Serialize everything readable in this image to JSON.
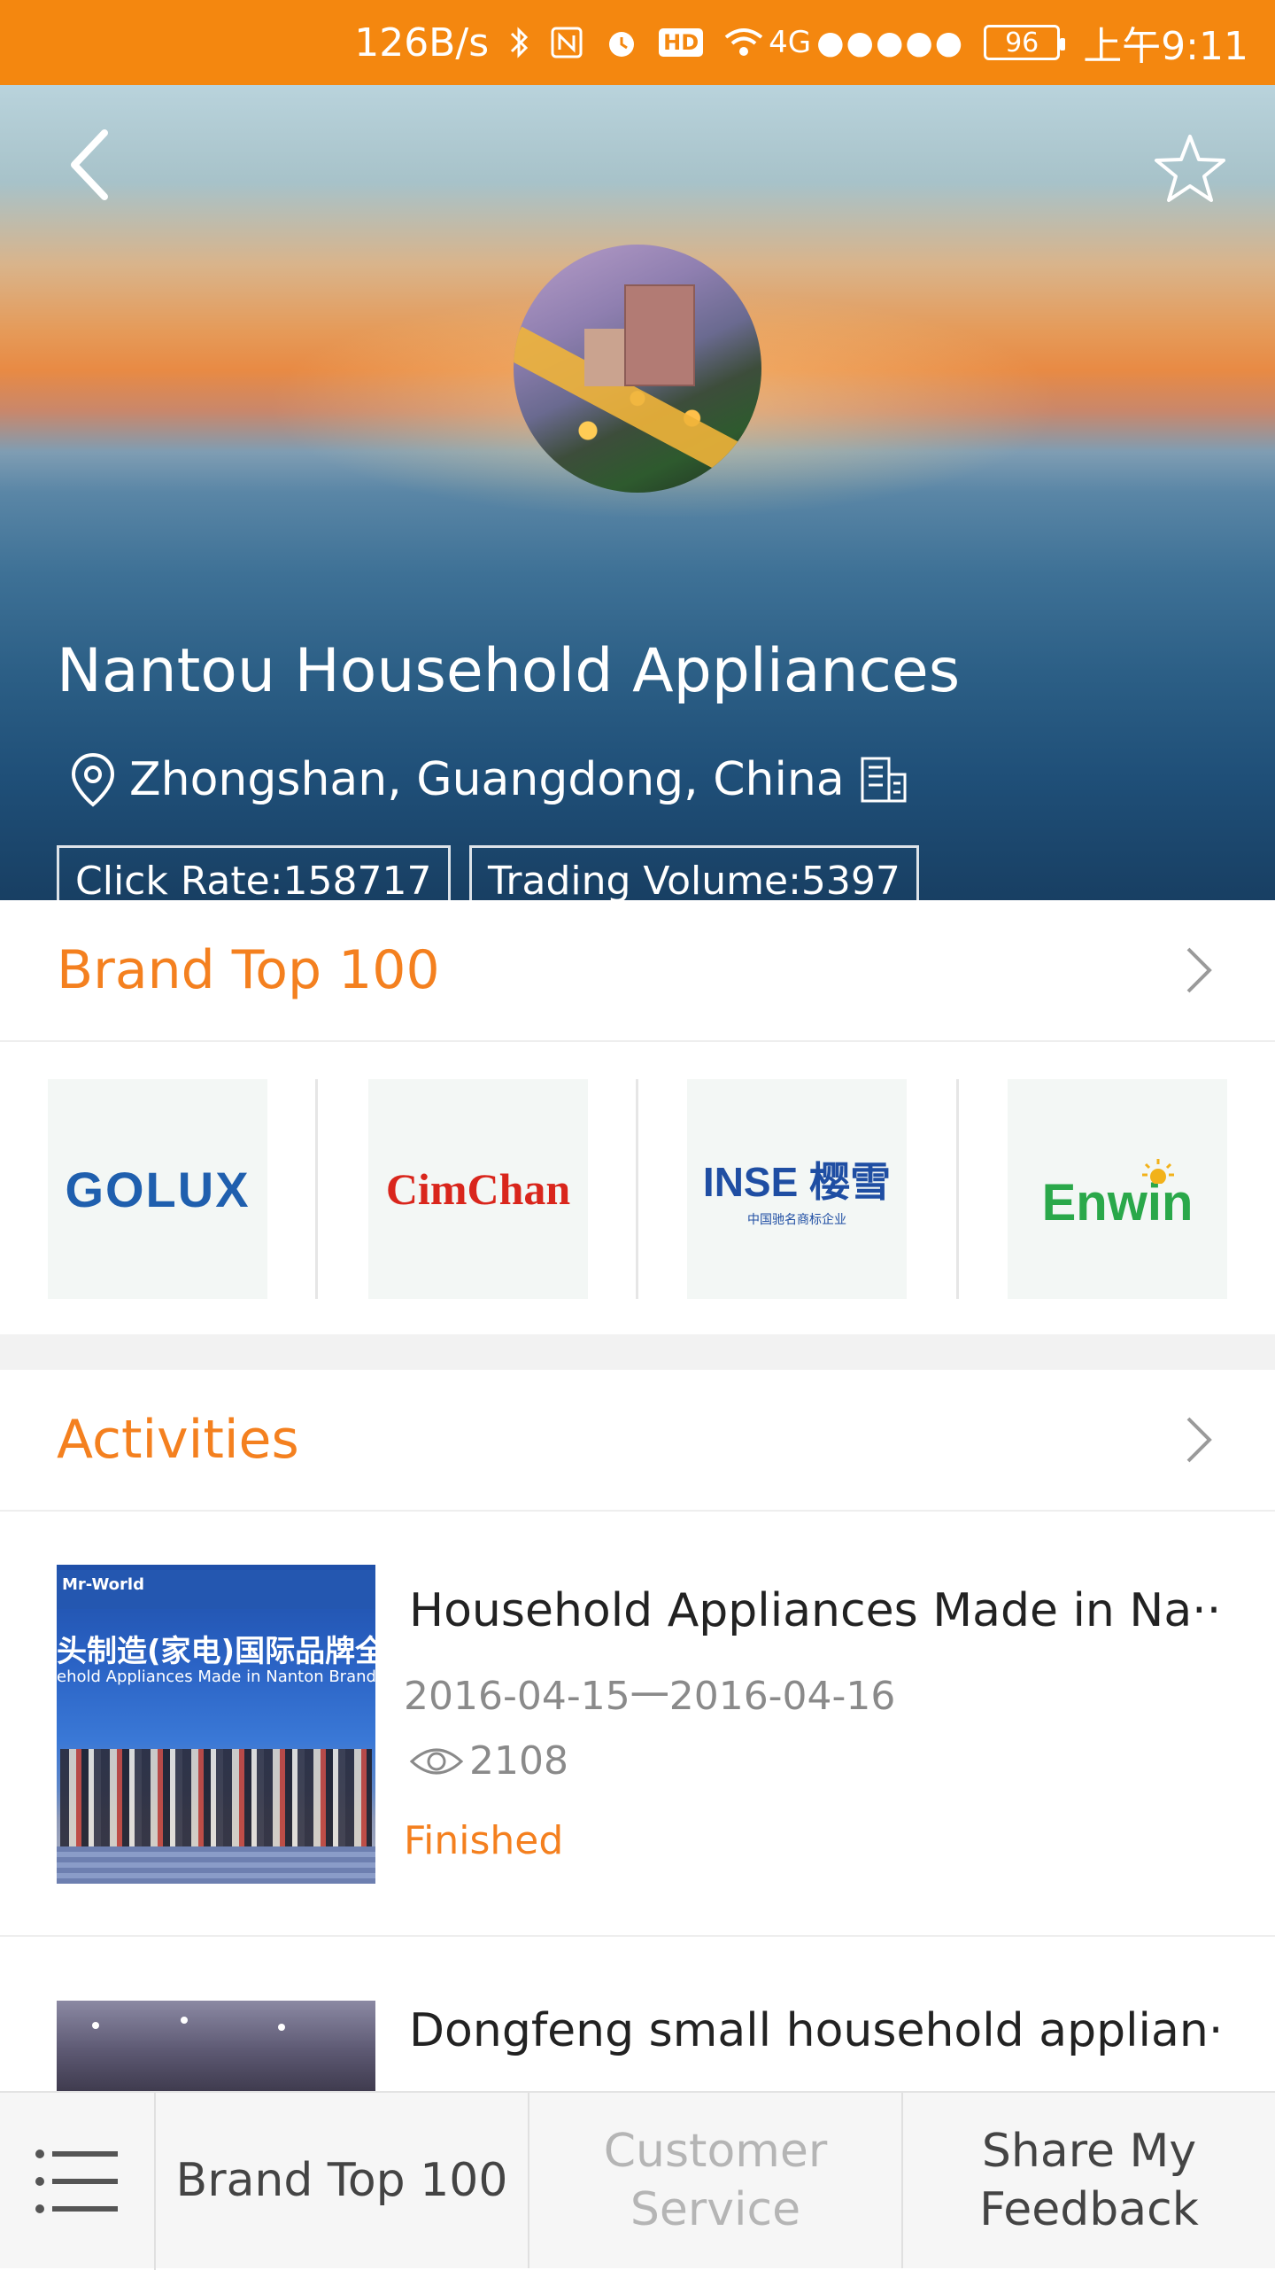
{
  "status_bar": {
    "network_speed": "126B/s",
    "network_type": "4G",
    "signal_dots": "●●●●●",
    "hd_badge": "HD",
    "battery": "96",
    "time": "上午9:11"
  },
  "company": {
    "name": "Nantou Household Appliances",
    "location": "Zhongshan, Guangdong, China",
    "click_rate": "Click Rate:158717",
    "trading_volume": "Trading Volume:5397"
  },
  "brand_section": {
    "title": "Brand Top 100",
    "brands": [
      {
        "name": "GOLUX",
        "color": "#1f5fae"
      },
      {
        "name": "CimChan",
        "color": "#d9261c"
      },
      {
        "name": "INSE 樱雪",
        "sub": "中国驰名商标企业",
        "color": "#1f4ea3"
      },
      {
        "name": "Enwin",
        "color": "#2aa84a"
      }
    ]
  },
  "activities_section": {
    "title": "Activities",
    "items": [
      {
        "title": "Household Appliances Made in Na···",
        "date": "2016-04-15一2016-04-16",
        "views": "2108",
        "status": "Finished",
        "banner_text": "头制造(家电)国际品牌全球发",
        "banner_text2": "ehold Appliances Made in Nanton Brands Global R"
      },
      {
        "title": "Dongfeng small household applian···"
      }
    ]
  },
  "bottom_bar": {
    "brand_top": "Brand Top 100",
    "customer_service": "Customer\nService",
    "share_feedback": "Share My\nFeedback"
  },
  "colors": {
    "accent": "#f4801f",
    "status_bar": "#f4870f"
  }
}
